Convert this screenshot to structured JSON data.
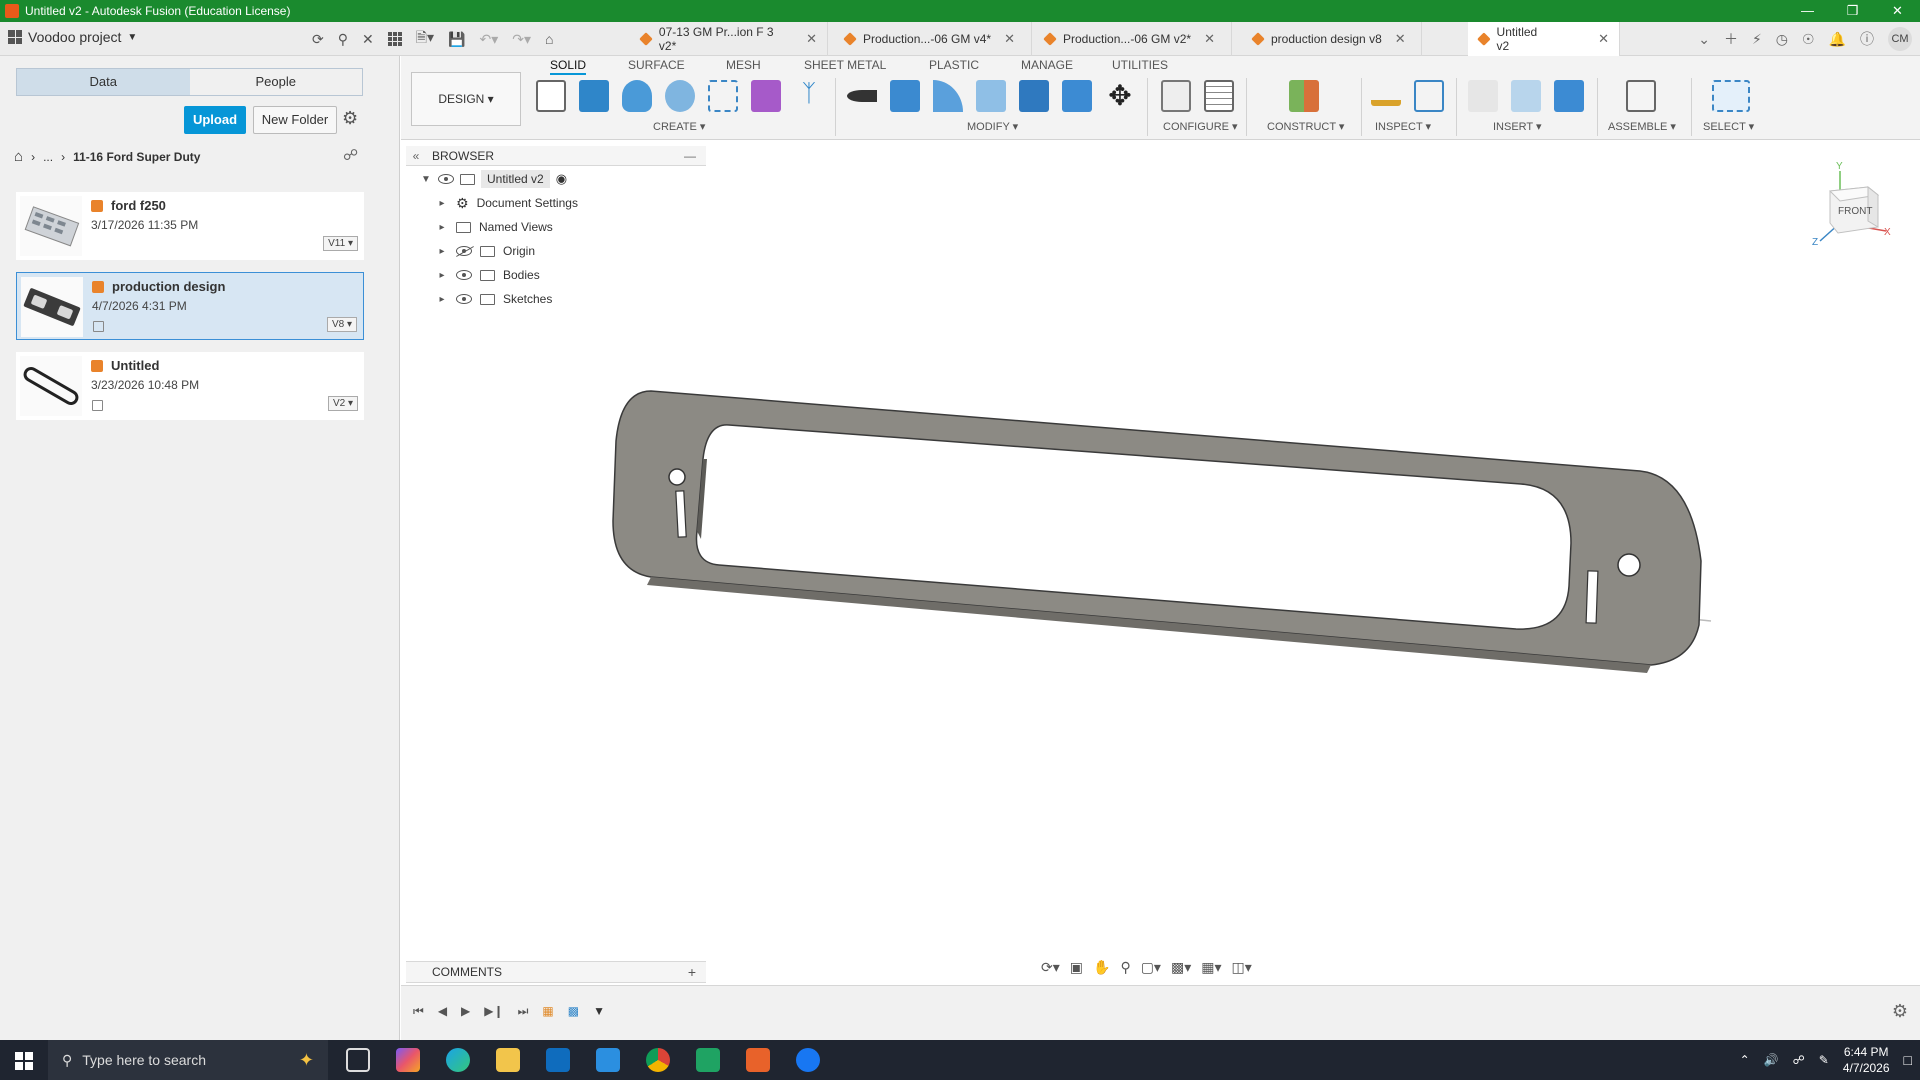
{
  "window": {
    "title": "Untitled v2 - Autodesk Fusion (Education License)",
    "minimize": "—",
    "restore": "❒",
    "close": "✕"
  },
  "project": {
    "name": "Voodoo project"
  },
  "doc_tabs": [
    {
      "label": "07-13 GM Pr...ion F 3 v2*",
      "close": "✕"
    },
    {
      "label": "Production...-06 GM v4*",
      "close": "✕"
    },
    {
      "label": "Production...-06 GM v2*",
      "close": "✕"
    },
    {
      "label": "production design v8",
      "close": "✕"
    },
    {
      "label": "Untitled v2",
      "close": "✕"
    }
  ],
  "user": {
    "initials": "CM"
  },
  "data_panel": {
    "tabs": [
      "Data",
      "People"
    ],
    "upload_label": "Upload",
    "new_folder_label": "New Folder",
    "breadcrumb": {
      "ellipsis": "...",
      "current": "11-16 Ford Super Duty"
    },
    "files": [
      {
        "name": "ford f250",
        "date": "3/17/2026 11:35 PM",
        "version": "V11 ▾"
      },
      {
        "name": "production design",
        "date": "4/7/2026 4:31 PM",
        "version": "V8 ▾"
      },
      {
        "name": "Untitled",
        "date": "3/23/2026 10:48 PM",
        "version": "V2 ▾"
      }
    ]
  },
  "ribbon": {
    "tabs": [
      "SOLID",
      "SURFACE",
      "MESH",
      "SHEET METAL",
      "PLASTIC",
      "MANAGE",
      "UTILITIES"
    ],
    "workspace": "DESIGN ▾",
    "groups": [
      "CREATE ▾",
      "MODIFY ▾",
      "CONFIGURE ▾",
      "CONSTRUCT ▾",
      "INSPECT ▾",
      "INSERT ▾",
      "ASSEMBLE ▾",
      "SELECT ▾"
    ]
  },
  "browser": {
    "title": "BROWSER",
    "root": "Untitled v2",
    "items": [
      "Document Settings",
      "Named Views",
      "Origin",
      "Bodies",
      "Sketches"
    ]
  },
  "viewcube": {
    "face": "FRONT",
    "axis_x": "X",
    "axis_y": "Y",
    "axis_z": "Z"
  },
  "comments": {
    "label": "COMMENTS",
    "add": "+"
  },
  "taskbar": {
    "search_placeholder": "Type here to search",
    "time": "6:44 PM",
    "date": "4/7/2026"
  },
  "colors": {
    "titlebar": "#1a8a2e",
    "accent": "#0696d7",
    "part_face": "#8c8a84",
    "part_edge": "#3a3a3a"
  }
}
